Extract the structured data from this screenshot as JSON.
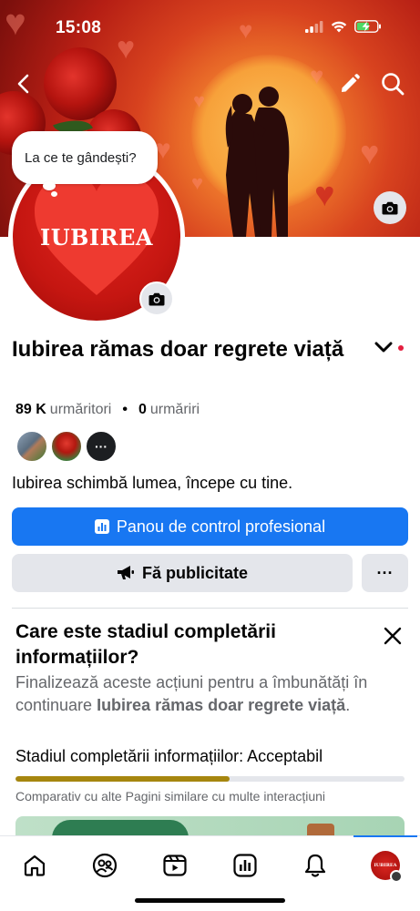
{
  "status_bar": {
    "time": "15:08"
  },
  "cover": {
    "bubble_placeholder": "La ce te gândești?"
  },
  "avatar": {
    "text": "IUBIREA"
  },
  "profile": {
    "name": "Iubirea rămas doar regrete viață",
    "followers_count": "89 K",
    "followers_label": "urmăritori",
    "separator": "•",
    "following_count": "0",
    "following_label": "urmăriri",
    "followers_more": "···",
    "bio": "Iubirea schimbă lumea, începe cu tine."
  },
  "actions": {
    "dashboard_label": "Panou de control profesional",
    "advertise_label": "Fă publicitate",
    "more_label": "···"
  },
  "completion_card": {
    "title": "Care este stadiul completării informațiilor?",
    "desc_prefix": "Finalizează aceste acțiuni pentru a îmbunătăți în continuare ",
    "desc_page": "Iubirea rămas doar regrete viață",
    "desc_suffix": ".",
    "status_label": "Stadiul completării informațiilor:",
    "status_value": "Acceptabil",
    "progress_fraction": 0.55,
    "note": "Comparativ cu alte Pagini similare cu multe interacțiuni"
  },
  "tabbar": {
    "items": [
      "home-icon",
      "friends-icon",
      "video-icon",
      "dashboard-icon",
      "notifications-icon",
      "profile-avatar"
    ],
    "avatar_text": "IUBIREA"
  },
  "colors": {
    "primary": "#1877f2",
    "progress": "#a6860f",
    "notification_dot": "#e41e3f"
  }
}
